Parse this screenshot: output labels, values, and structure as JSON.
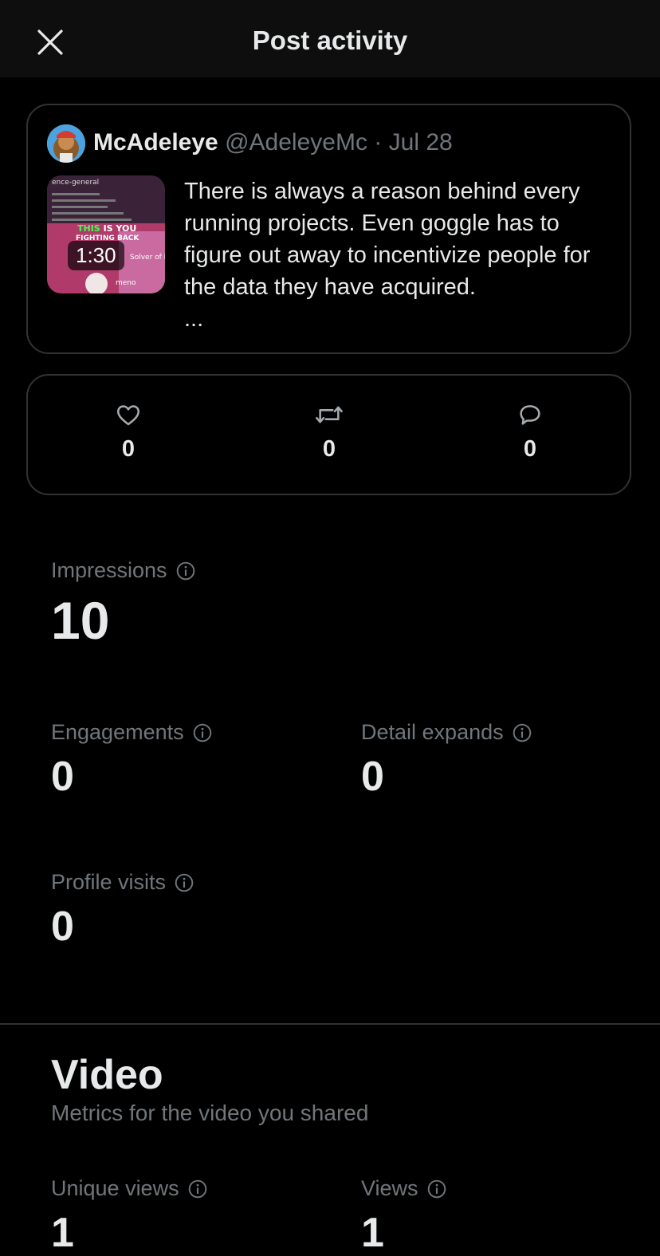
{
  "header": {
    "title": "Post activity",
    "close_icon": "close-icon"
  },
  "post": {
    "author_name": "McAdeleye",
    "author_handle": "@AdeleyeMc",
    "separator": "·",
    "date": "Jul 28",
    "text": "There is always a reason behind every running projects. Even goggle has to figure out away to incentivize people for the data they have acquired.",
    "ellipsis": "...",
    "video_duration": "1:30",
    "thumbnail_text": {
      "channel": "ence-general",
      "headline_green": "THIS",
      "headline_white": "IS YOU",
      "headline_2": "FIGHTING BACK",
      "side_label": "Solver of P",
      "user_label": "meno"
    }
  },
  "engagement": {
    "likes": {
      "icon": "heart-icon",
      "count": "0"
    },
    "reposts": {
      "icon": "repost-icon",
      "count": "0"
    },
    "replies": {
      "icon": "reply-icon",
      "count": "0"
    }
  },
  "metrics": {
    "impressions": {
      "label": "Impressions",
      "value": "10"
    },
    "engagements": {
      "label": "Engagements",
      "value": "0"
    },
    "detail_expands": {
      "label": "Detail expands",
      "value": "0"
    },
    "profile_visits": {
      "label": "Profile visits",
      "value": "0"
    }
  },
  "video": {
    "title": "Video",
    "subtitle": "Metrics for the video you shared",
    "unique_views": {
      "label": "Unique views",
      "value": "1"
    },
    "views": {
      "label": "Views",
      "value": "1"
    }
  },
  "colors": {
    "background": "#000000",
    "header_bg": "#0e0e0e",
    "text_primary": "#e7e9ea",
    "text_secondary": "#71767b",
    "border": "#2f3336"
  }
}
